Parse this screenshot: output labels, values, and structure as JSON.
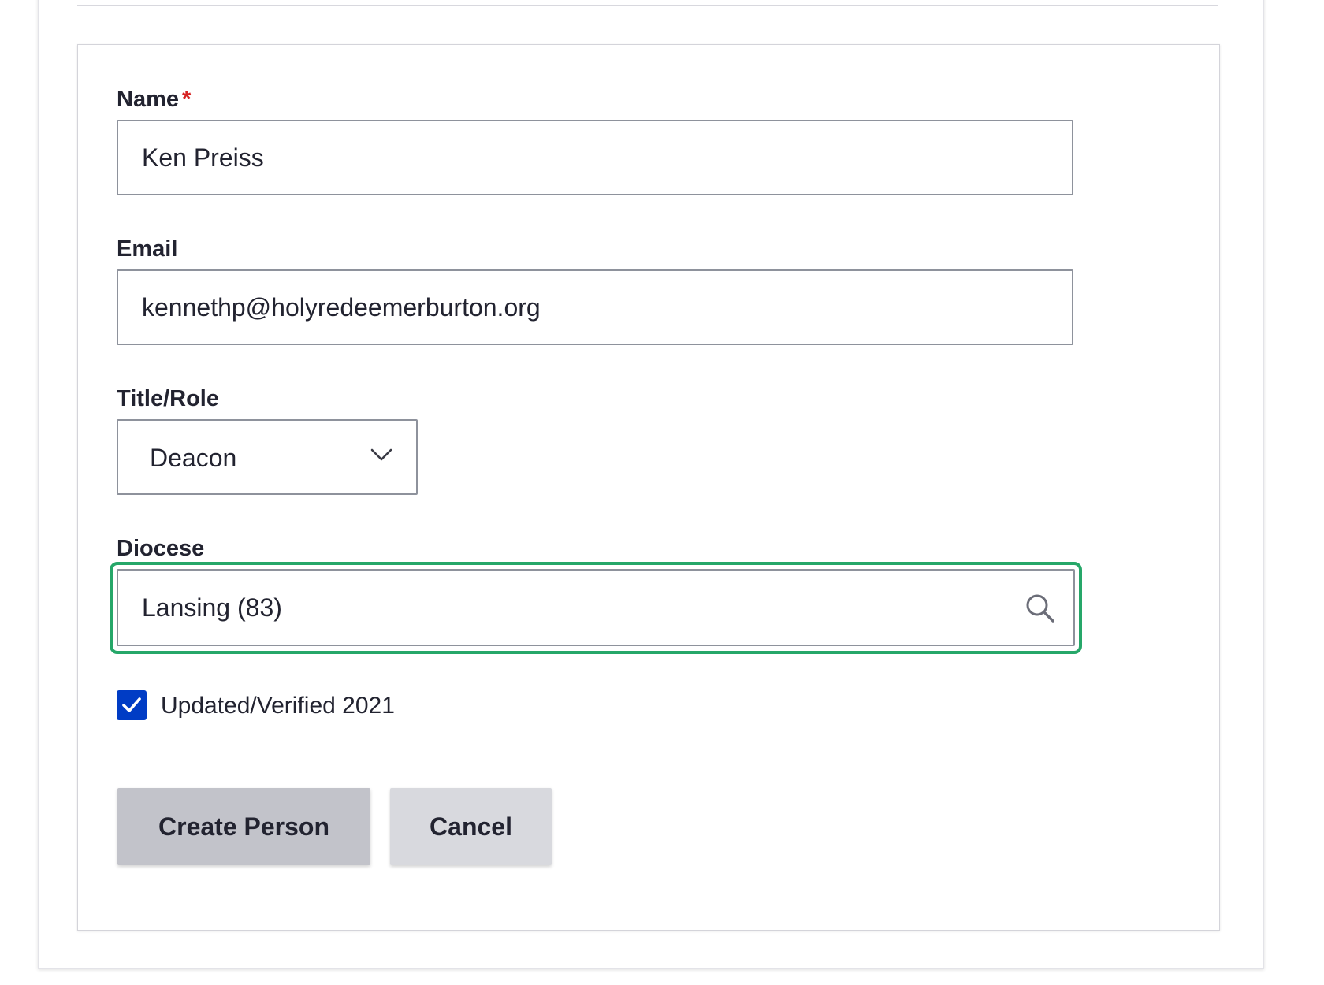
{
  "form": {
    "name": {
      "label": "Name",
      "required_marker": "*",
      "value": "Ken Preiss"
    },
    "email": {
      "label": "Email",
      "value": "kennethp@holyredeemerburton.org"
    },
    "title_role": {
      "label": "Title/Role",
      "selected": "Deacon",
      "icon": "chevron-down-icon"
    },
    "diocese": {
      "label": "Diocese",
      "value": "Lansing (83)",
      "icon": "search-icon",
      "focused": true,
      "focus_color": "#26a769"
    },
    "verified": {
      "label": "Updated/Verified 2021",
      "checked": true,
      "check_color": "#003cc5"
    }
  },
  "actions": {
    "create_label": "Create Person",
    "cancel_label": "Cancel"
  }
}
